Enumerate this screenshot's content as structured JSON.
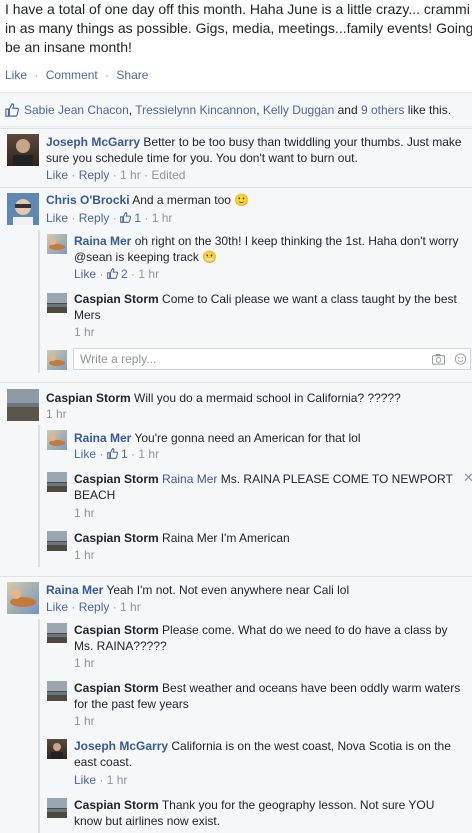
{
  "post": {
    "lines": [
      "I have a total of one day off this month. Haha June is a little crazy... crammi",
      "in as many things as possible. Gigs, media, meetings...family events! Going",
      "be an insane month!"
    ],
    "actions": [
      "Like",
      "Comment",
      "Share"
    ],
    "separator": "·"
  },
  "likes": {
    "names": [
      "Sabie Jean Chacon",
      "Tressielynn Kincannon",
      "Kelly Duggan"
    ],
    "comma": ",",
    "and": "and",
    "others": "9 others",
    "suffix": "like this."
  },
  "comments": [
    {
      "name": "Joseph McGarry",
      "text": "Better to be too busy than twiddling your thumbs. Just make",
      "text2": "sure you schedule time for you. You don't want to burn out.",
      "like": "Like",
      "reply": "Reply",
      "time": "1 hr",
      "edited": "Edited"
    },
    {
      "name": "Chris O'Brocki",
      "text": "And a merman too",
      "emoji": "🙂",
      "like": "Like",
      "reply": "Reply",
      "count": "1",
      "time": "1 hr"
    },
    {
      "name": "Raina Mer",
      "text": "oh right on the 30th! I keep thinking the 1st. Haha don't worry",
      "text2": "@sean is keeping track",
      "emoji": "😬",
      "like": "Like",
      "count": "2",
      "time": "1 hr"
    },
    {
      "name": "Caspian Storm",
      "text": "Come to Cali please we want a class taught by the best",
      "text2": "Mers",
      "time": "1 hr"
    },
    {
      "name": "Caspian Storm",
      "text": "Will you do a mermaid school in California? ?????",
      "time": "1 hr"
    },
    {
      "name": "Raina Mer",
      "text": "You're gonna need an American for that lol",
      "like": "Like",
      "count": "1",
      "time": "1 hr"
    },
    {
      "name": "Caspian Storm",
      "mention": "Raina Mer",
      "text": "Ms. RAINA PLEASE COME TO NEWPORT",
      "text2": "BEACH",
      "time": "1 hr"
    },
    {
      "name": "Caspian Storm",
      "text": "Raina Mer I'm American",
      "time": "1 hr"
    },
    {
      "name": "Raina Mer",
      "text": "Yeah I'm not. Not even anywhere near Cali lol",
      "like": "Like",
      "reply": "Reply",
      "time": "1 hr"
    },
    {
      "name": "Caspian Storm",
      "text": "Please come. What do we need to do have a class by",
      "text2": "Ms. RAINA?????",
      "time": "1 hr"
    },
    {
      "name": "Caspian Storm",
      "text": "Best weather and oceans have been oddly warm waters",
      "text2": "for the past few years",
      "time": "1 hr"
    },
    {
      "name": "Joseph McGarry",
      "text": "California is on the west coast, Nova Scotia is on the",
      "text2": "east coast.",
      "like": "Like",
      "time": "1 hr"
    },
    {
      "name": "Caspian Storm",
      "text": "Thank you for the geography lesson. Not sure YOU",
      "text2": "know but airlines now exist."
    }
  ],
  "write_reply": {
    "placeholder": "Write a reply..."
  },
  "close_glyph": "✕",
  "colors": {
    "link": "#365899",
    "meta": "#90949c",
    "background": "#f6f7f9"
  }
}
